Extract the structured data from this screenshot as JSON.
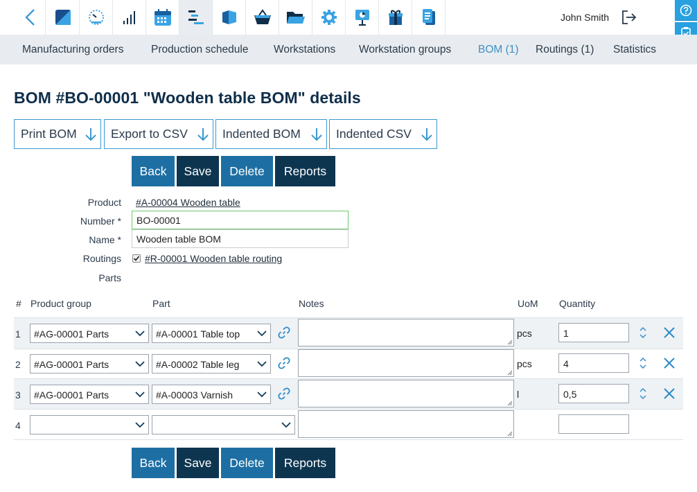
{
  "header": {
    "user_name": "John Smith",
    "toolbar_icons": [
      "chevron-left-icon",
      "logo-icon",
      "dashboard-gauge-icon",
      "signal-bars-icon",
      "calendar-icon",
      "gantt-icon",
      "box-icon",
      "basket-icon",
      "folder-icon",
      "gear-icon",
      "presentation-icon",
      "gift-icon",
      "documents-icon",
      "logout-icon",
      "help-icon",
      "checklist-icon"
    ]
  },
  "nav": {
    "items": [
      {
        "label": "Manufacturing orders"
      },
      {
        "label": "Production schedule"
      },
      {
        "label": "Workstations"
      },
      {
        "label": "Workstation groups"
      },
      {
        "label": "BOM (1)"
      },
      {
        "label": "Routings (1)"
      },
      {
        "label": "Statistics"
      }
    ]
  },
  "page": {
    "title": "BOM #BO-00001 \"Wooden table BOM\" details"
  },
  "downloads": {
    "print_bom": "Print BOM",
    "export_csv": "Export to CSV",
    "indented_bom": "Indented BOM",
    "indented_csv": "Indented CSV"
  },
  "actions": {
    "back": "Back",
    "save": "Save",
    "delete": "Delete",
    "reports": "Reports"
  },
  "form": {
    "product_label": "Product",
    "product_value": "#A-00004 Wooden table",
    "number_label": "Number *",
    "number_value": "BO-00001",
    "name_label": "Name *",
    "name_value": "Wooden table BOM",
    "routings_label": "Routings",
    "routing_value": "#R-00001 Wooden table routing",
    "routing_checked": true,
    "parts_label": "Parts"
  },
  "table": {
    "headers": {
      "num": "#",
      "product_group": "Product group",
      "part": "Part",
      "notes": "Notes",
      "uom": "UoM",
      "quantity": "Quantity"
    },
    "rows": [
      {
        "num": "1",
        "product_group": "#AG-00001 Parts",
        "part": "#A-00001 Table top",
        "notes": "",
        "uom": "pcs",
        "quantity": "1"
      },
      {
        "num": "2",
        "product_group": "#AG-00001 Parts",
        "part": "#A-00002 Table leg",
        "notes": "",
        "uom": "pcs",
        "quantity": "4"
      },
      {
        "num": "3",
        "product_group": "#AG-00001 Parts",
        "part": "#A-00003 Varnish",
        "notes": "",
        "uom": "l",
        "quantity": "0,5"
      },
      {
        "num": "4",
        "product_group": "",
        "part": "",
        "notes": "",
        "uom": "",
        "quantity": ""
      }
    ]
  },
  "colors": {
    "accent": "#29a0e0",
    "primary_button": "#1d6fa3",
    "dark_button": "#0d3550",
    "title": "#0f2e4a",
    "nav_bg": "#e8ecf0"
  }
}
